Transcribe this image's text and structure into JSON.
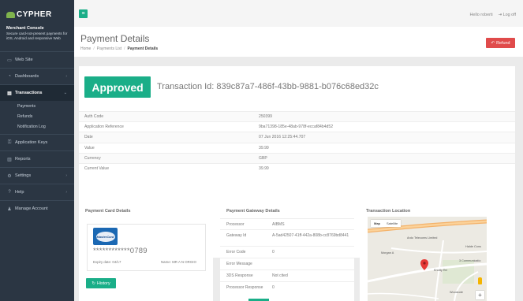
{
  "sidebar": {
    "logo_main": "CYPHER",
    "logo_accent": "",
    "brand_title": "Merchant Console",
    "brand_subtitle": "Secure card-not-present payments for iOS, Android and responsive Web",
    "items": [
      {
        "label": "Web Site",
        "icon": "monitor-icon"
      },
      {
        "label": "Dashboards",
        "icon": "dashboard-icon"
      },
      {
        "label": "Transactions",
        "icon": "list-icon",
        "active": true
      },
      {
        "label": "Application Keys",
        "icon": "key-icon"
      },
      {
        "label": "Reports",
        "icon": "report-icon"
      },
      {
        "label": "Settings",
        "icon": "cogs-icon"
      },
      {
        "label": "Help",
        "icon": "help-icon"
      },
      {
        "label": "Manage Account",
        "icon": "user-icon"
      }
    ],
    "sub_items": [
      {
        "label": "Payments"
      },
      {
        "label": "Refunds"
      },
      {
        "label": "Notification Log"
      }
    ]
  },
  "topbar": {
    "greeting": "Hello roberti",
    "logoff": "Log off"
  },
  "header": {
    "title": "Payment Details",
    "breadcrumb": [
      "Home",
      "Payments List",
      "Payment Details"
    ],
    "refund_label": "Refund"
  },
  "transaction": {
    "status": "Approved",
    "id_label": "Transaction Id: 839c87a7-486f-43bb-9881-b076c68ed32c",
    "details": [
      {
        "key": "Auth Code",
        "value": "250399"
      },
      {
        "key": "Application Reference",
        "value": "9ba71398-185e-48ab-978f-eccaf84b4d52"
      },
      {
        "key": "Date",
        "value": "07 Jun 2016 12:25:44.707"
      },
      {
        "key": "Value",
        "value": "39.99"
      },
      {
        "key": "Currency",
        "value": "GBP"
      },
      {
        "key": "Current Value",
        "value": "39.99"
      }
    ]
  },
  "payment_card": {
    "title": "Payment Card Details",
    "brand": "MasterCard",
    "number": "************0789",
    "expiry": "Expiry date: 04/17",
    "name": "Name: MR A N ORGIO",
    "history_label": "History"
  },
  "gateway": {
    "title": "Payment Gateway Details",
    "rows": [
      {
        "key": "Processor",
        "value": "AIBMS"
      },
      {
        "key": "Gateway Id",
        "value": "A-5ad42507-41ff-442a-808b-cc8769bd8441"
      },
      {
        "key": "Error Code",
        "value": "0"
      },
      {
        "key": "Error Message",
        "value": ""
      },
      {
        "key": "3DS Response",
        "value": "Not cited"
      },
      {
        "key": "Processor Response",
        "value": "0"
      }
    ]
  },
  "location": {
    "title": "Transaction Location",
    "map_tabs": [
      "Map",
      "Satellite"
    ],
    "labels": [
      "Ardo Telecoms Limited",
      "Morgan A",
      "Knotty Rd",
      "Halde Cons",
      "3 Communicatio",
      "Woodcote"
    ],
    "colors": {
      "road_major": "#f4b26a",
      "road_minor": "#ffffff",
      "pin": "#e53935"
    }
  },
  "colors": {
    "accent": "#1aae88",
    "danger": "#e04b4b",
    "sidebar": "#2b3643"
  }
}
